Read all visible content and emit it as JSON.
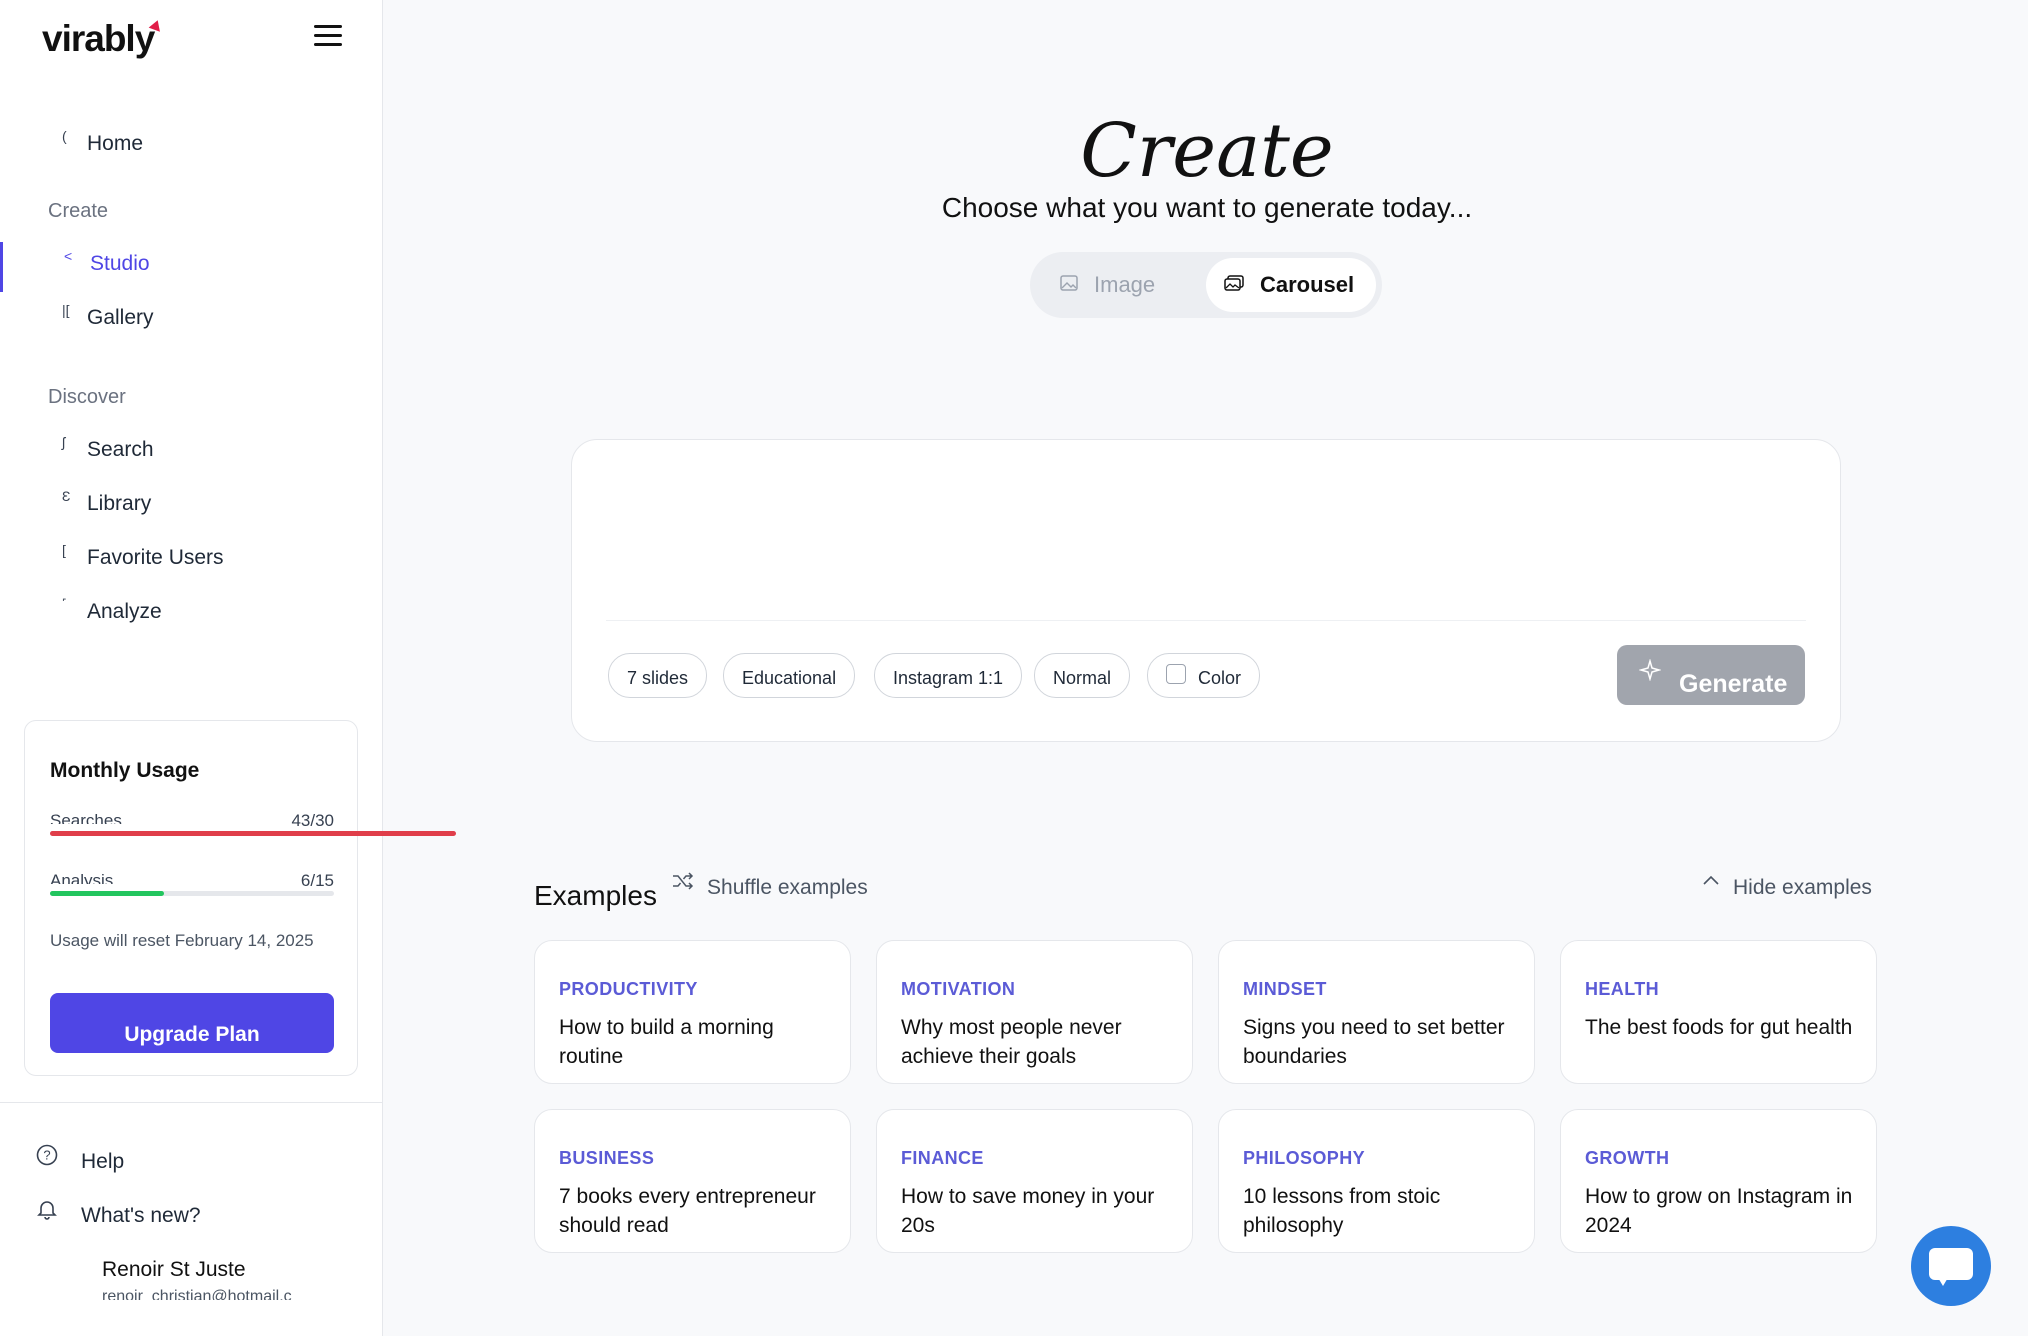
{
  "brand": {
    "name": "virably",
    "accent": "#4f46e5",
    "logo_dot": "#e11d48"
  },
  "sidebar": {
    "menu_icon": "hamburger-icon",
    "home": {
      "label": "Home",
      "icon": "("
    },
    "sections": {
      "create": "Create",
      "discover": "Discover"
    },
    "create_items": [
      {
        "label": "Studio",
        "icon": "<",
        "active": true
      },
      {
        "label": "Gallery",
        "icon": "|["
      }
    ],
    "discover_items": [
      {
        "label": "Search",
        "icon": "ʃ"
      },
      {
        "label": "Library",
        "icon": "Ɛ"
      },
      {
        "label": "Favorite Users",
        "icon": "["
      },
      {
        "label": "Analyze",
        "icon": "˹"
      }
    ],
    "usage": {
      "title": "Monthly Usage",
      "searches": {
        "label": "Searches",
        "count": "43/30",
        "used": 43,
        "limit": 30,
        "color": "#e03e4a"
      },
      "analysis": {
        "label": "Analysis",
        "count": "6/15",
        "used": 6,
        "limit": 15,
        "color": "#22c55e"
      },
      "reset_text": "Usage will reset February 14, 2025",
      "upgrade_label": "Upgrade Plan"
    },
    "help_label": "Help",
    "whats_new_label": "What's new?",
    "user": {
      "name": "Renoir St Juste",
      "email": "renoir_christian@hotmail.c"
    }
  },
  "main": {
    "title": "Create",
    "subtitle": "Choose what you want to generate today...",
    "toggle": {
      "image": "Image",
      "carousel": "Carousel",
      "selected": "Carousel"
    },
    "prompt": {
      "value": "",
      "chips": [
        "7 slides",
        "Educational",
        "Instagram 1:1",
        "Normal"
      ],
      "color_chip": "Color",
      "generate_label": "Generate"
    },
    "examples": {
      "heading": "Examples",
      "shuffle_label": "Shuffle examples",
      "hide_label": "Hide examples",
      "cards": [
        {
          "category": "PRODUCTIVITY",
          "text": "How to build a morning routine"
        },
        {
          "category": "MOTIVATION",
          "text": "Why most people never achieve their goals"
        },
        {
          "category": "MINDSET",
          "text": "Signs you need to set better boundaries"
        },
        {
          "category": "HEALTH",
          "text": "The best foods for gut health"
        },
        {
          "category": "BUSINESS",
          "text": "7 books every entrepreneur should read"
        },
        {
          "category": "FINANCE",
          "text": "How to save money in your 20s"
        },
        {
          "category": "PHILOSOPHY",
          "text": "10 lessons from stoic philosophy"
        },
        {
          "category": "GROWTH",
          "text": "How to grow on Instagram in 2024"
        }
      ]
    },
    "chat_icon": "chat-bubble-icon"
  }
}
